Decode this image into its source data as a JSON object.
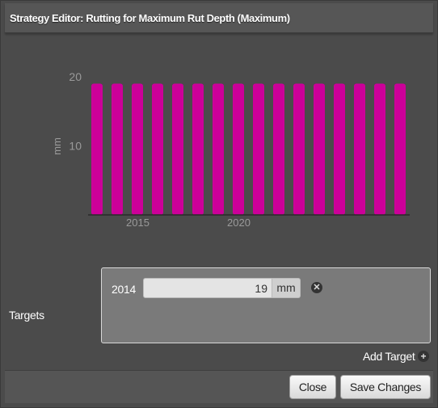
{
  "dialog": {
    "title": "Strategy Editor: Rutting for Maximum Rut Depth (Maximum)"
  },
  "chart_data": {
    "type": "bar",
    "x": [
      2014,
      2015,
      2016,
      2017,
      2018,
      2019,
      2020,
      2021,
      2022,
      2023,
      2024,
      2025,
      2026,
      2027,
      2028,
      2029
    ],
    "values": [
      19,
      19,
      19,
      19,
      19,
      19,
      19,
      19,
      19,
      19,
      19,
      19,
      19,
      19,
      19,
      19
    ],
    "xticks": [
      "2015",
      "2020"
    ],
    "yticks": [
      "10",
      "20"
    ],
    "ylabel": "mm",
    "ylim": [
      0,
      20
    ],
    "color": "#cc0099",
    "grid": false
  },
  "targets": {
    "label": "Targets",
    "items": [
      {
        "year": "2014",
        "value": "19",
        "unit": "mm"
      }
    ],
    "add_label": "Add Target"
  },
  "footer": {
    "close_label": "Close",
    "save_label": "Save Changes"
  },
  "icons": {
    "remove": "remove-icon",
    "add": "add-icon"
  }
}
